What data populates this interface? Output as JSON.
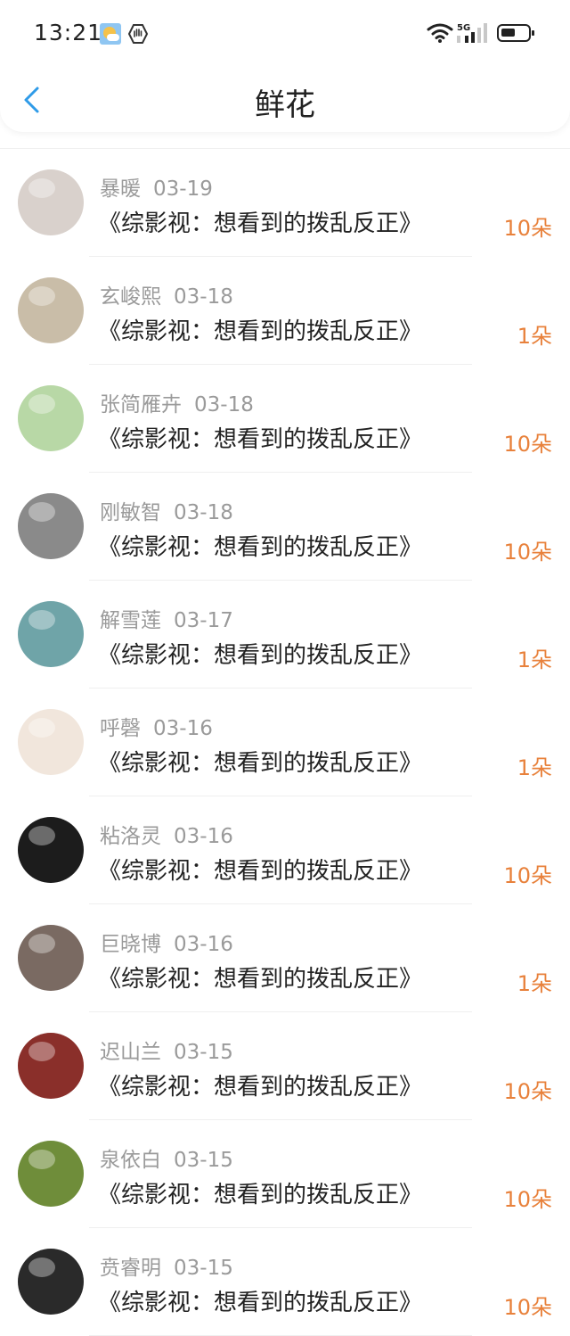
{
  "status_bar": {
    "time": "13:21",
    "network": "5G"
  },
  "nav": {
    "title": "鲜花"
  },
  "items": [
    {
      "name": "暴暖",
      "date": "03-19",
      "title": "《综影视：想看到的拨乱反正》",
      "count": "10朵",
      "avatar_color": "#d9d1cc"
    },
    {
      "name": "玄峻熙",
      "date": "03-18",
      "title": "《综影视：想看到的拨乱反正》",
      "count": "1朵",
      "avatar_color": "#c9bda8"
    },
    {
      "name": "张简雁卉",
      "date": "03-18",
      "title": "《综影视：想看到的拨乱反正》",
      "count": "10朵",
      "avatar_color": "#b8d8a6"
    },
    {
      "name": "刚敏智",
      "date": "03-18",
      "title": "《综影视：想看到的拨乱反正》",
      "count": "10朵",
      "avatar_color": "#8a8a8a"
    },
    {
      "name": "解雪莲",
      "date": "03-17",
      "title": "《综影视：想看到的拨乱反正》",
      "count": "1朵",
      "avatar_color": "#6fa4a8"
    },
    {
      "name": "呼磬",
      "date": "03-16",
      "title": "《综影视：想看到的拨乱反正》",
      "count": "1朵",
      "avatar_color": "#f1e6dc"
    },
    {
      "name": "粘洛灵",
      "date": "03-16",
      "title": "《综影视：想看到的拨乱反正》",
      "count": "10朵",
      "avatar_color": "#1c1c1c"
    },
    {
      "name": "巨晓博",
      "date": "03-16",
      "title": "《综影视：想看到的拨乱反正》",
      "count": "1朵",
      "avatar_color": "#7a6a62"
    },
    {
      "name": "迟山兰",
      "date": "03-15",
      "title": "《综影视：想看到的拨乱反正》",
      "count": "10朵",
      "avatar_color": "#8a2f2a"
    },
    {
      "name": "泉依白",
      "date": "03-15",
      "title": "《综影视：想看到的拨乱反正》",
      "count": "10朵",
      "avatar_color": "#6f8d3a"
    },
    {
      "name": "贲睿明",
      "date": "03-15",
      "title": "《综影视：想看到的拨乱反正》",
      "count": "10朵",
      "avatar_color": "#2a2a2a"
    }
  ]
}
